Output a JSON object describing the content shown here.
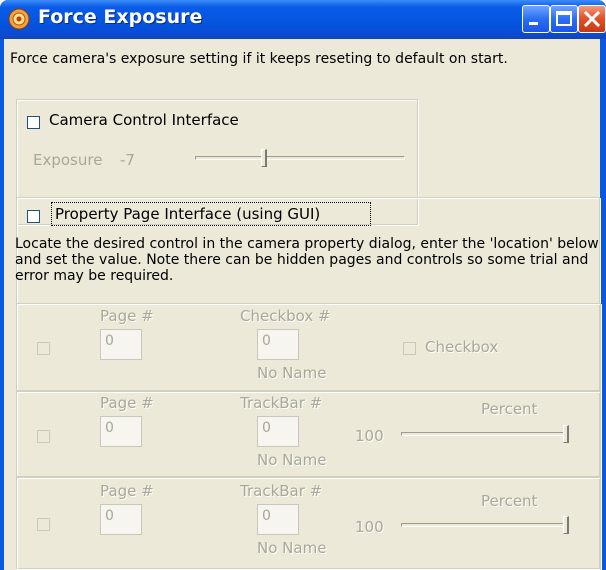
{
  "window": {
    "title": "Force Exposure"
  },
  "description": "Force camera's exposure setting if it keeps reseting to default on start.",
  "camera_control": {
    "checkbox_label": "Camera Control Interface",
    "checked": false,
    "exposure_label": "Exposure",
    "exposure_value": "-7"
  },
  "property_page": {
    "checkbox_label": "Property Page Interface (using GUI)",
    "checked": false,
    "instructions": "Locate the desired control in the camera property dialog, enter the 'location' below and set the value. Note there can be hidden pages and controls so some trial and error may be required.",
    "rows": [
      {
        "page_label": "Page #",
        "page_value": "0",
        "control_label": "Checkbox #",
        "control_value": "0",
        "name": "No Name",
        "checkbox_label": "Checkbox"
      },
      {
        "page_label": "Page #",
        "page_value": "0",
        "control_label": "TrackBar #",
        "control_value": "0",
        "name": "No Name",
        "percent_label": "Percent",
        "percent_value": "100",
        "percent_level": 1.0
      },
      {
        "page_label": "Page #",
        "page_value": "0",
        "control_label": "TrackBar #",
        "control_value": "0",
        "name": "No Name",
        "percent_label": "Percent",
        "percent_value": "100",
        "percent_level": 1.0
      }
    ]
  }
}
